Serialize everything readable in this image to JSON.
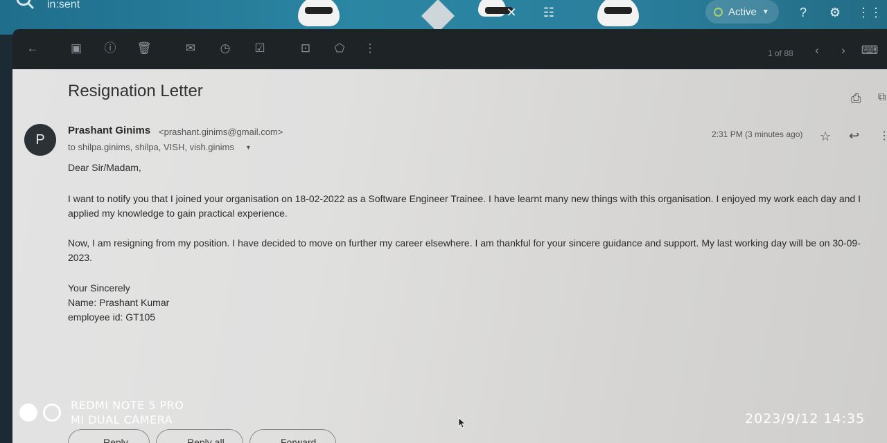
{
  "theme": {
    "search_text": "in:sent",
    "status_label": "Active",
    "status_color": "#a8d26a"
  },
  "toolbar": {
    "icons": [
      "back-arrow-icon",
      "archive-icon",
      "report-spam-icon",
      "delete-icon",
      "mark-unread-icon",
      "snooze-icon",
      "add-task-icon",
      "move-to-icon",
      "label-icon",
      "more-vert-icon"
    ],
    "pager_text": "1 of 88"
  },
  "message": {
    "subject": "Resignation Letter",
    "avatar_letter": "P",
    "sender_name": "Prashant Ginims",
    "sender_email": "<prashant.ginims@gmail.com>",
    "recipients": "to shilpa.ginims, shilpa, VISH, vish.ginims",
    "timestamp": "2:31 PM (3 minutes ago)",
    "body": {
      "greeting": "Dear Sir/Madam,",
      "para1": "I want to notify you that I joined your organisation on 18-02-2022 as a Software Engineer Trainee. I have learnt many new things with this organisation. I enjoyed my work each day and I applied my knowledge to gain practical experience.",
      "para2": "Now, I am resigning from my position. I have decided to move on further my career elsewhere. I am thankful for your sincere guidance and support. My last working day will be on 30-09-2023.",
      "sign_line1": "Your Sincerely",
      "sign_line2": "Name: Prashant Kumar",
      "sign_line3": "employee id: GT105"
    }
  },
  "actions": {
    "reply": "Reply",
    "reply_all": "Reply all",
    "forward": "Forward"
  },
  "watermark": {
    "model": "REDMI NOTE 5 PRO",
    "camera": "MI DUAL CAMERA",
    "datetime": "2023/9/12  14:35"
  }
}
